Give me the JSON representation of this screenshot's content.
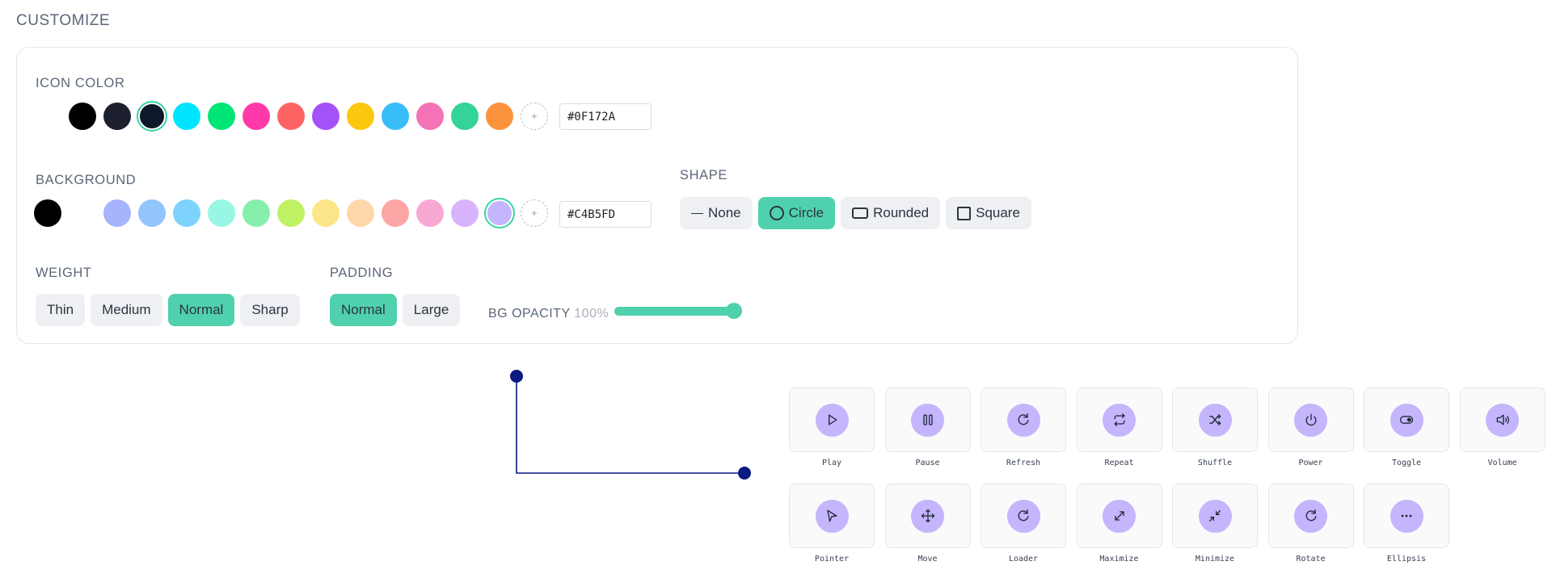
{
  "section_title": "CUSTOMIZE",
  "icon_color": {
    "label": "ICON COLOR",
    "swatches": [
      "#000000",
      "#1b1f2e",
      "#0f172a",
      "#00e5ff",
      "#00e676",
      "#ff3aa8",
      "#ff6464",
      "#a451f7",
      "#fcc70f",
      "#38bdf8",
      "#f472b6",
      "#34d399",
      "#fb923c"
    ],
    "selected": "#0f172a",
    "hex_value": "#0F172A",
    "add_label": "+"
  },
  "background": {
    "label": "BACKGROUND",
    "swatches": [
      "#000000",
      "transparent",
      "#a5b4fc",
      "#93c5fd",
      "#7dd3fc",
      "#99f6e4",
      "#86efac",
      "#bef264",
      "#fde68a",
      "#fed7aa",
      "#fca5a5",
      "#f9a8d4",
      "#d8b4fe",
      "#c4b5fd"
    ],
    "selected": "#c4b5fd",
    "hex_value": "#C4B5FD",
    "add_label": "+"
  },
  "shape": {
    "label": "SHAPE",
    "options": [
      {
        "label": "None",
        "icon": "dash-icon",
        "active": false
      },
      {
        "label": "Circle",
        "icon": "circle-outline-icon",
        "active": true
      },
      {
        "label": "Rounded",
        "icon": "rounded-rect-icon",
        "active": false
      },
      {
        "label": "Square",
        "icon": "square-icon",
        "active": false
      }
    ]
  },
  "weight": {
    "label": "WEIGHT",
    "options": [
      {
        "label": "Thin",
        "active": false
      },
      {
        "label": "Medium",
        "active": false
      },
      {
        "label": "Normal",
        "active": true
      },
      {
        "label": "Sharp",
        "active": false
      }
    ]
  },
  "padding": {
    "label": "PADDING",
    "options": [
      {
        "label": "Normal",
        "active": true
      },
      {
        "label": "Large",
        "active": false
      }
    ]
  },
  "bg_opacity": {
    "label": "BG OPACITY",
    "value_text": "100%",
    "value": 1.0
  },
  "accent_color": "#4fd1ad",
  "connector_color": "#0b1a80",
  "icons": [
    {
      "label": "Play",
      "icon": "play-icon"
    },
    {
      "label": "Pause",
      "icon": "pause-icon"
    },
    {
      "label": "Refresh",
      "icon": "refresh-icon"
    },
    {
      "label": "Repeat",
      "icon": "repeat-icon"
    },
    {
      "label": "Shuffle",
      "icon": "shuffle-icon"
    },
    {
      "label": "Power",
      "icon": "power-icon"
    },
    {
      "label": "Toggle",
      "icon": "toggle-icon"
    },
    {
      "label": "Volume",
      "icon": "volume-icon"
    },
    {
      "label": "Pointer",
      "icon": "pointer-icon"
    },
    {
      "label": "Move",
      "icon": "move-icon"
    },
    {
      "label": "Loader",
      "icon": "loader-icon"
    },
    {
      "label": "Maximize",
      "icon": "maximize-icon"
    },
    {
      "label": "Minimize",
      "icon": "minimize-icon"
    },
    {
      "label": "Rotate",
      "icon": "rotate-icon"
    },
    {
      "label": "Ellipsis",
      "icon": "ellipsis-icon"
    }
  ]
}
